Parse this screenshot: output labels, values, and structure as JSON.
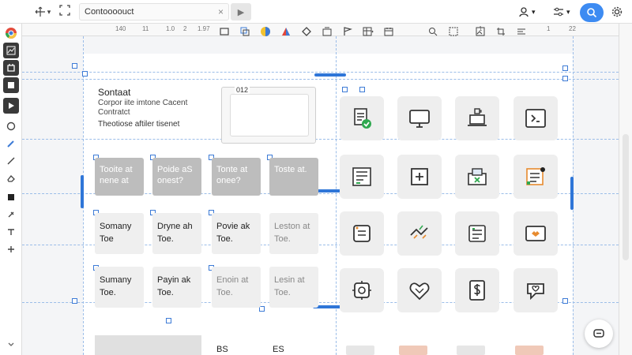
{
  "topbar": {
    "doc_title": "Contoooouct",
    "close_glyph": "×",
    "play_glyph": "▶",
    "dropdown_glyph": "▾"
  },
  "ruler": {
    "ticks": [
      "140",
      "11",
      "1.0",
      "2",
      "1.97",
      "1",
      "1",
      "22"
    ]
  },
  "canvas": {
    "heading": "Sontaat",
    "subheading_1": "Corpor iite imtone Cacent",
    "subheading_2": "Contratct",
    "subheading_3": "Theotiose aftiler tisenet",
    "input_label": "012",
    "grey_cards": [
      {
        "line1": "Tooite at",
        "line2": "nene at"
      },
      {
        "line1": "Poide aS",
        "line2": "onest?"
      },
      {
        "line1": "Tonte at",
        "line2": "onee?"
      },
      {
        "line1": "Toste at.",
        "line2": ""
      }
    ],
    "row2_cards": [
      {
        "line1": "Somany",
        "line2": "Toe"
      },
      {
        "line1": "Dryne ah",
        "line2": "Toe."
      },
      {
        "line1": "Povie ak",
        "line2": "Toe."
      },
      {
        "line1": "Leston at",
        "line2": "Toe."
      }
    ],
    "row3_cards": [
      {
        "line1": "Sumany",
        "line2": "Toe."
      },
      {
        "line1": "Payin ak",
        "line2": "Toe."
      },
      {
        "line1": "Enoin at",
        "line2": "Toe."
      },
      {
        "line1": "Lesin at",
        "line2": "Toe."
      }
    ],
    "bottom_label_1": "BS",
    "bottom_label_2": "ES"
  },
  "icons": {
    "row1": [
      "doc-check-icon",
      "monitor-icon",
      "laptop-mug-icon",
      "code-window-icon"
    ],
    "row2": [
      "form-list-icon",
      "plus-box-icon",
      "tool-box-icon",
      "checklist-icon"
    ],
    "row3": [
      "frame-icon",
      "chart-spark-icon",
      "report-icon",
      "monitor-heart-icon"
    ],
    "row4": [
      "settings-chip-icon",
      "puzzle-heart-icon",
      "dollar-doc-icon",
      "chat-heart-icon"
    ]
  },
  "colors": {
    "accent": "#3d8bf2",
    "selection": "#2f76d8",
    "guide": "#9bbde8"
  }
}
